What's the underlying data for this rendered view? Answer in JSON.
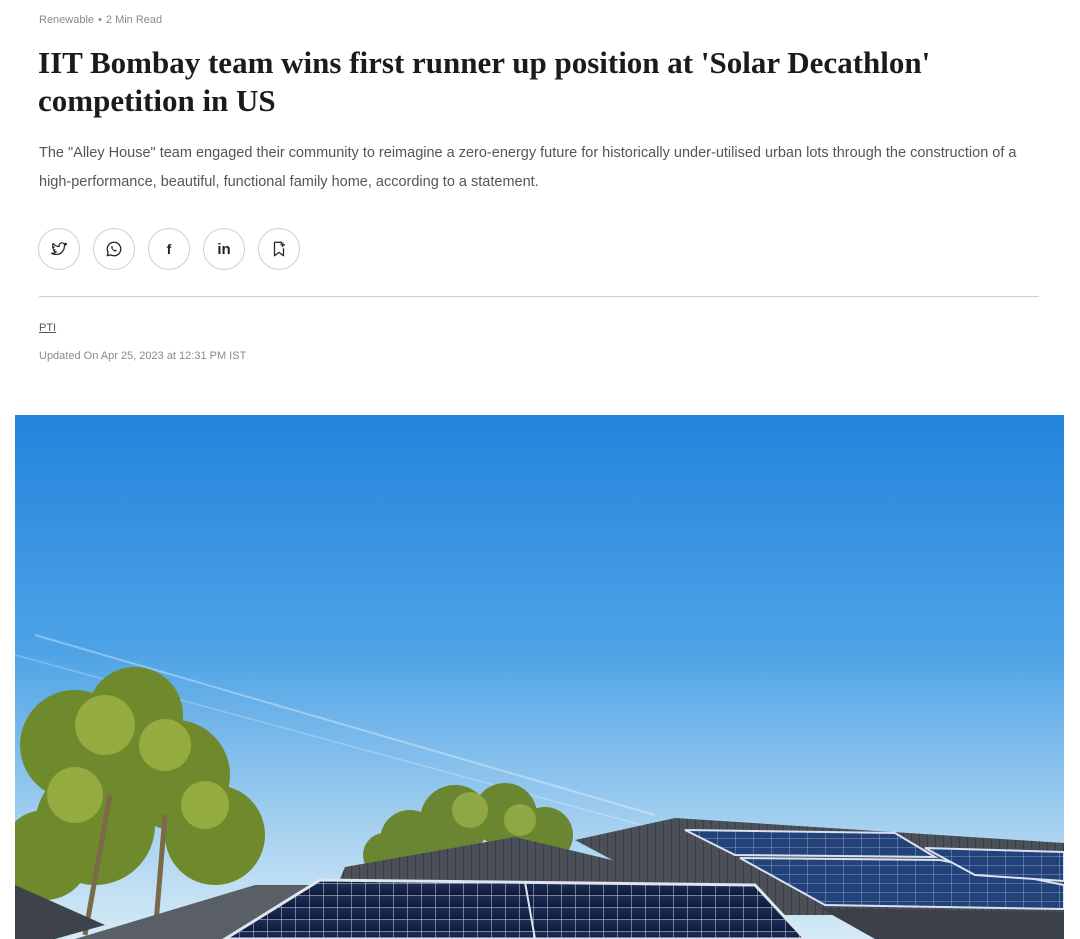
{
  "article": {
    "category": "Renewable",
    "separator": "•",
    "read_time": "2 Min Read",
    "headline": "IIT Bombay team wins first runner up position at 'Solar Decathlon' competition in US",
    "summary": "The \"Alley House\" team engaged their community to reimagine a zero-energy future for historically under-utilised urban lots through the construction of a high-performance, beautiful, functional family home, according to a statement.",
    "author": "PTI",
    "updated": "Updated On Apr 25, 2023 at 12:31 PM IST"
  },
  "share": {
    "buttons": [
      {
        "name": "twitter",
        "icon": "twitter-icon"
      },
      {
        "name": "whatsapp",
        "icon": "whatsapp-icon"
      },
      {
        "name": "facebook",
        "icon": "facebook-icon",
        "glyph": "f"
      },
      {
        "name": "linkedin",
        "icon": "linkedin-icon",
        "glyph": "in"
      },
      {
        "name": "bookmark",
        "icon": "bookmark-icon"
      }
    ]
  },
  "hero_image": {
    "subject": "solar panels on house roofs under blue sky with trees"
  },
  "colors": {
    "sky_top": "#2b8fe0",
    "sky_bottom": "#cfe6f6",
    "divider": "#d0d0d0",
    "muted_text": "#8a8a8a"
  }
}
